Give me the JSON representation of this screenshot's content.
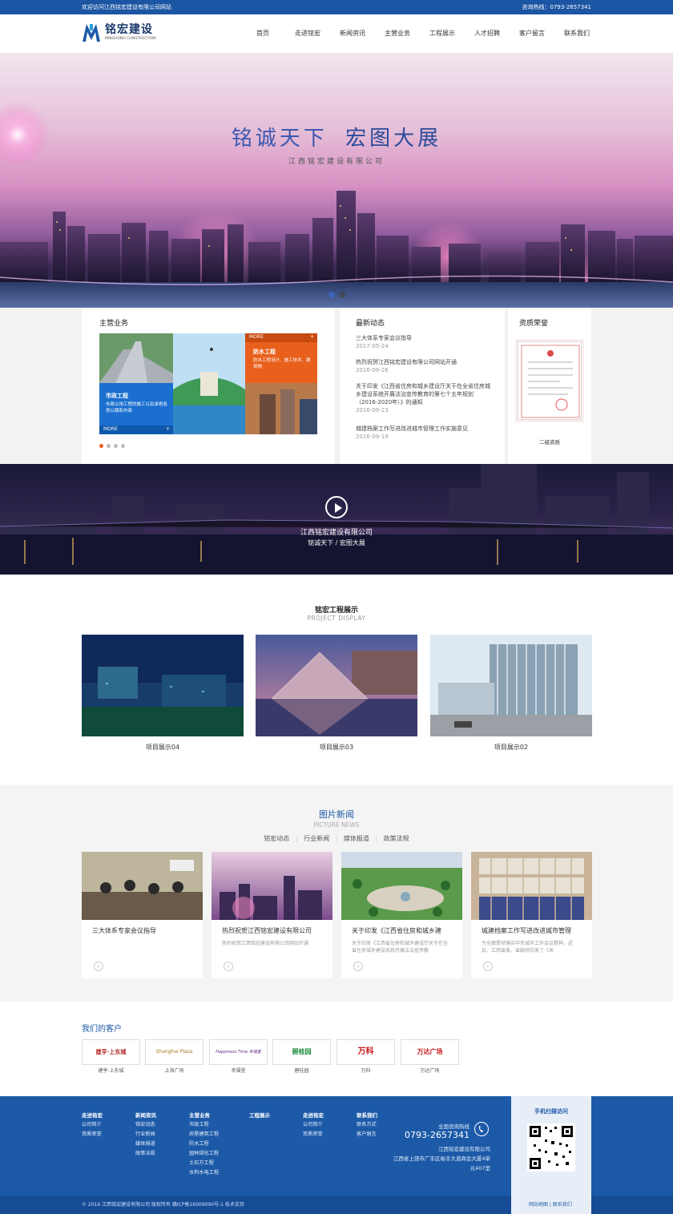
{
  "topbar": {
    "welcome": "欢迎访问江西铭宏建设有限公司网站",
    "hotline": "咨询热线：0793-2657341"
  },
  "logo": {
    "cn": "铭宏建设",
    "en": "MINGHONG CONSTRUCTION"
  },
  "nav": [
    "首页",
    "走进铭宏",
    "新闻资讯",
    "主营业务",
    "工程展示",
    "人才招聘",
    "客户留言",
    "联系我们"
  ],
  "banner": {
    "title1": "铭诚天下",
    "title2": "宏图大展",
    "subtitle": "江西铭宏建设有限公司"
  },
  "business": {
    "heading": "主营业务",
    "more1": "MORE",
    "card_orange_title": "防水工程",
    "card_orange_text": "防水工程设计、施工技术、建筑物",
    "more2": "MORE",
    "card_blue_title": "市政工程",
    "card_blue_text": "市政公用工程的施工以及承担各类公路和市政"
  },
  "latest": {
    "heading": "最新动态",
    "items": [
      {
        "title": "三大体系专家会议指导",
        "date": "2017-05-24"
      },
      {
        "title": "热烈祝贺江西铭宏建设有限公司网站开通",
        "date": "2016-09-26"
      },
      {
        "title": "关于印发《江西省住房和城乡建设厅关于在全省住房城乡建设系统开展法治宣传教育的第七个五年规划（2016-2020年）》的通知",
        "date": "2016-09-23"
      },
      {
        "title": "城建档案工作写进改进城市管理工作实施意见",
        "date": "2016-09-19"
      }
    ]
  },
  "honor": {
    "heading": "资质荣誉",
    "caption": "二级资质"
  },
  "video": {
    "company": "江西铭宏建设有限公司",
    "slogan": "铭诚天下 / 宏图大展"
  },
  "projects": {
    "title": "铭宏工程展示",
    "en": "PROJECT DISPLAY",
    "items": [
      "项目展示04",
      "项目展示03",
      "项目展示02"
    ]
  },
  "picnews": {
    "title": "图片新闻",
    "en": "PICTURE NEWS",
    "tabs": [
      "铭宏动态",
      "行业新闻",
      "媒体报道",
      "政策法规"
    ],
    "sep": "|",
    "arrow": "›",
    "items": [
      {
        "title": "三大体系专家会议指导",
        "summary": ""
      },
      {
        "title": "热烈祝贺江西铭宏建设有限公司",
        "summary": "热烈祝贺江西铭宏建设有限公司网站开通"
      },
      {
        "title": "关于印发《江西省住房和城乡建",
        "summary": "关于印发《江西省住房和城乡建设厅关于在全省住房城乡建设系统开展法治宣传教"
      },
      {
        "title": "城建档案工作写进改进城市管理",
        "summary": "为全面贯彻落实中央城市工作会议精神，近日，江西省委、省政府印发了《关"
      }
    ]
  },
  "clients": {
    "heading": "我们的客户",
    "items": [
      {
        "logo_text": "建亨·上东城",
        "caption": "建亨·上东城"
      },
      {
        "logo_text": "Shanghai Plaza",
        "caption": "上海广场"
      },
      {
        "logo_text": "Happiness Time 幸福里",
        "caption": "幸福里"
      },
      {
        "logo_text": "碧桂园",
        "caption": "碧桂园"
      },
      {
        "logo_text": "万科",
        "caption": "万科"
      },
      {
        "logo_text": "万达广场",
        "caption": "万达广场"
      }
    ]
  },
  "footer": {
    "cols": [
      {
        "h": "走进铭宏",
        "items": [
          "公司简介",
          "资质荣誉"
        ]
      },
      {
        "h": "新闻资讯",
        "items": [
          "铭宏动态",
          "行业新闻",
          "媒体报道",
          "政策法规"
        ]
      },
      {
        "h": "主营业务",
        "items": [
          "市政工程",
          "房屋建筑工程",
          "防水工程",
          "园林绿化工程",
          "土石方工程",
          "水利水电工程"
        ]
      },
      {
        "h": "工程展示",
        "items": []
      },
      {
        "h": "走进铭宏",
        "items": [
          "公司简介",
          "资质荣誉"
        ]
      },
      {
        "h": "联系我们",
        "items": [
          "联系方式",
          "客户留言"
        ]
      }
    ],
    "hotline_label": "全国咨询热线",
    "hotline": "0793-2657341",
    "company": "江西铭宏建设有限公司",
    "address": "江西省上饶市广丰区裕丰大道商会大厦4单元407室",
    "qr_title": "手机扫描访问",
    "copyright": "© 2016 江西铭宏建设有限公司 版权所有 赣ICP备16009090号-1 技术支持",
    "links": "网站地图 | 联系我们"
  },
  "colors": {
    "brand": "#1b55a3",
    "orange": "#e8601c",
    "blue_card": "#1a6fcf"
  }
}
